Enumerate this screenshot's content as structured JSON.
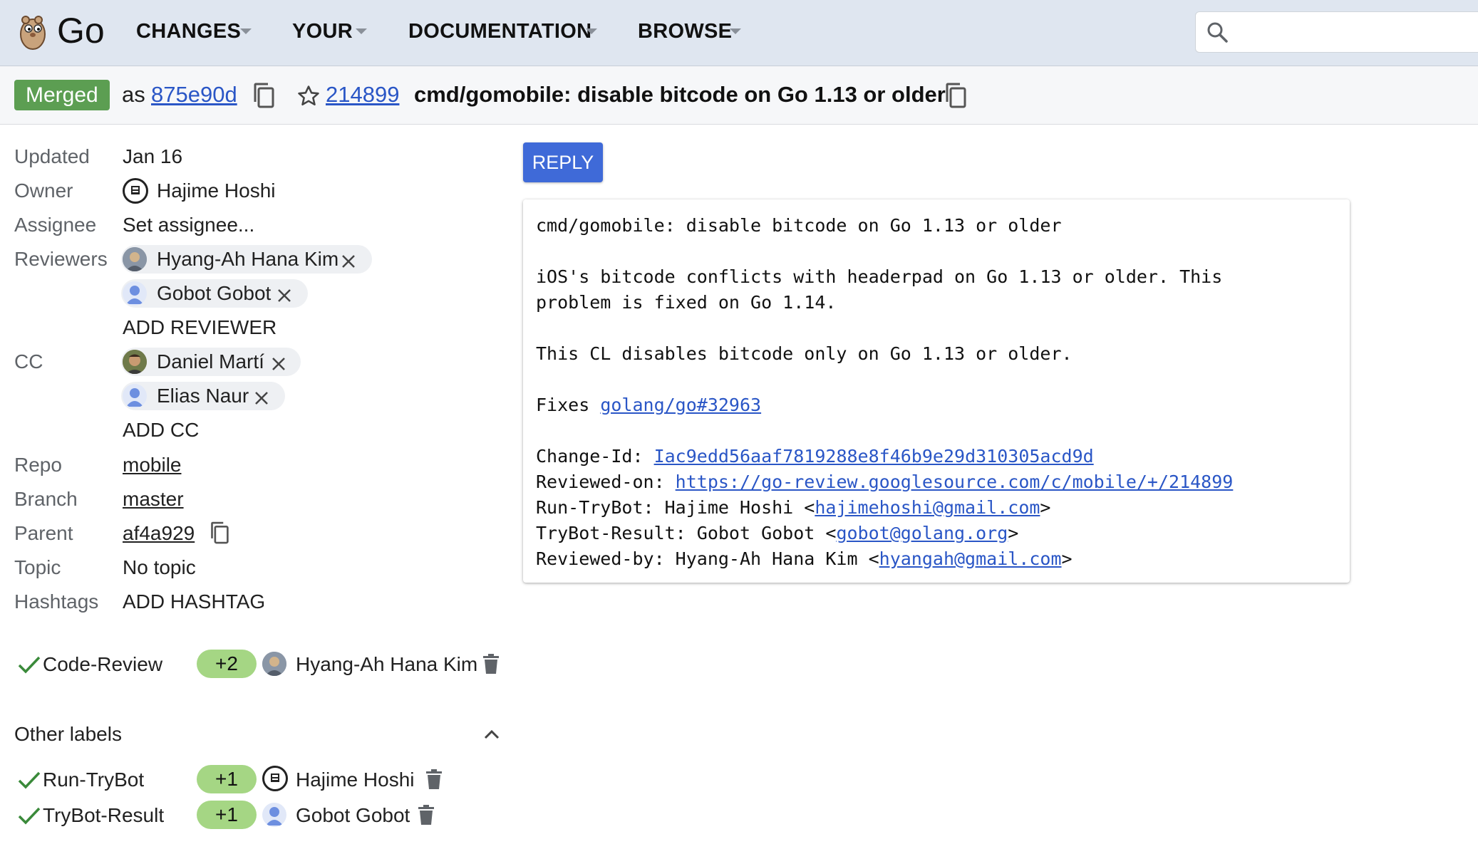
{
  "header": {
    "app_title": "Go",
    "nav": [
      {
        "label": "CHANGES"
      },
      {
        "label": "YOUR"
      },
      {
        "label": "DOCUMENTATION"
      },
      {
        "label": "BROWSE"
      }
    ],
    "search": {
      "placeholder": ""
    }
  },
  "change": {
    "status": "Merged",
    "as_label": "as",
    "commit": "875e90d",
    "number": "214899",
    "subject": "cmd/gomobile: disable bitcode on Go 1.13 or older"
  },
  "meta": {
    "updated_label": "Updated",
    "updated": "Jan 16",
    "owner_label": "Owner",
    "owner": "Hajime Hoshi",
    "assignee_label": "Assignee",
    "assignee": "Set assignee...",
    "reviewers_label": "Reviewers",
    "reviewers": [
      {
        "name": "Hyang-Ah Hana Kim"
      },
      {
        "name": "Gobot Gobot"
      }
    ],
    "add_reviewer": "ADD REVIEWER",
    "cc_label": "CC",
    "cc": [
      {
        "name": "Daniel Martí"
      },
      {
        "name": "Elias Naur"
      }
    ],
    "add_cc": "ADD CC",
    "repo_label": "Repo",
    "repo": "mobile",
    "branch_label": "Branch",
    "branch": "master",
    "parent_label": "Parent",
    "parent": "af4a929",
    "topic_label": "Topic",
    "topic": "No topic",
    "hashtags_label": "Hashtags",
    "add_hashtag": "ADD HASHTAG"
  },
  "labels": {
    "code_review": {
      "name": "Code-Review",
      "vote": "+2",
      "voter": "Hyang-Ah Hana Kim"
    },
    "other_heading": "Other labels",
    "other": [
      {
        "name": "Run-TryBot",
        "vote": "+1",
        "voter": "Hajime Hoshi"
      },
      {
        "name": "TryBot-Result",
        "vote": "+1",
        "voter": "Gobot Gobot"
      }
    ]
  },
  "reply": {
    "label": "REPLY"
  },
  "message": {
    "line1": "cmd/gomobile: disable bitcode on Go 1.13 or older",
    "line2": "iOS's bitcode conflicts with headerpad on Go 1.13 or older. This",
    "line3": "problem is fixed on Go 1.14.",
    "line4": "This CL disables bitcode only on Go 1.13 or older.",
    "fixes_prefix": "Fixes ",
    "fixes_link": "golang/go#32963",
    "changeid_prefix": "Change-Id: ",
    "changeid": "Iac9edd56aaf7819288e8f46b9e29d310305acd9d",
    "reviewed_on_prefix": "Reviewed-on: ",
    "reviewed_on": "https://go-review.googlesource.com/c/mobile/+/214899",
    "runtrybot_prefix": "Run-TryBot: Hajime Hoshi <",
    "runtrybot_email": "hajimehoshi@gmail.com",
    "trybotresult_prefix": "TryBot-Result: Gobot Gobot <",
    "trybotresult_email": "gobot@golang.org",
    "reviewedby_prefix": "Reviewed-by: Hyang-Ah Hana Kim <",
    "reviewedby_email": "hyangah@gmail.com",
    "close_bracket": ">"
  },
  "colors": {
    "accent": "#3f6ad8",
    "merged": "#5c9e52",
    "vote_positive": "#a5d684",
    "link": "#2a56c6"
  }
}
